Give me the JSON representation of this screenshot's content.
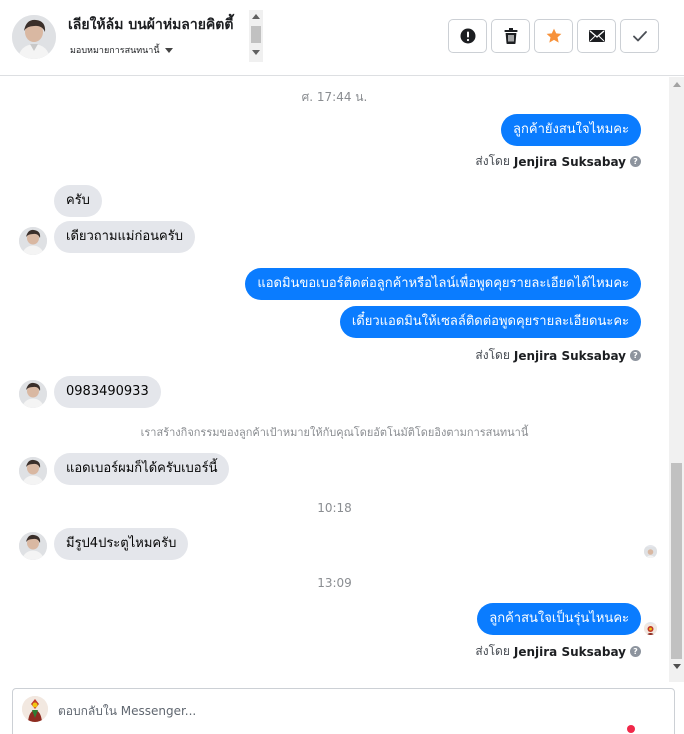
{
  "header": {
    "contact_name": "เลียให้ล้ม บนผ้าห่มลายคิตตี้",
    "assign_label": "มอบหมายการสนทนานี้",
    "tools": [
      {
        "name": "mark-spam-button",
        "icon": "alert-circle-icon"
      },
      {
        "name": "delete-button",
        "icon": "trash-icon"
      },
      {
        "name": "star-button",
        "icon": "star-icon"
      },
      {
        "name": "mark-unread-button",
        "icon": "envelope-icon"
      },
      {
        "name": "mark-done-button",
        "icon": "check-icon"
      }
    ],
    "star_color": "#f7923b"
  },
  "conversation": {
    "stamp_1": "ศ. 17:44 น.",
    "out_1": "ลูกค้ายังสนใจไหมคะ",
    "sent_by_prefix": "ส่งโดย",
    "sender": "Jenjira Suksabay",
    "in_1": "ครับ",
    "in_2": "เดียวถามแม่ก่อนครับ",
    "out_2": "แอดมินขอเบอร์ติดต่อลูกค้าหรือไลน์เพื่อพูดคุยรายละเอียดได้ไหมคะ",
    "out_3": "เดี๋ยวแอดมินให้เซลล์ติดต่อพูดคุยรายละเอียดนะคะ",
    "in_3": "0983490933",
    "system_note": "เราสร้างกิจกรรมของลูกค้าเป้าหมายให้กับคุณโดยอัตโนมัติโดยอิงตามการสนทนานี้",
    "in_4": "แอดเบอร์ผมก็ได้ครับเบอร์นี้",
    "stamp_2": "10:18",
    "in_5": "มีรูป4ประตูไหมครับ",
    "stamp_3": "13:09",
    "out_4": "ลูกค้าสนใจเป็นรุ่นไหนคะ"
  },
  "composer": {
    "placeholder": "ตอบกลับใน Messenger..."
  },
  "colors": {
    "outgoing_bubble": "#0a7cff",
    "incoming_bubble": "#e4e6eb"
  }
}
